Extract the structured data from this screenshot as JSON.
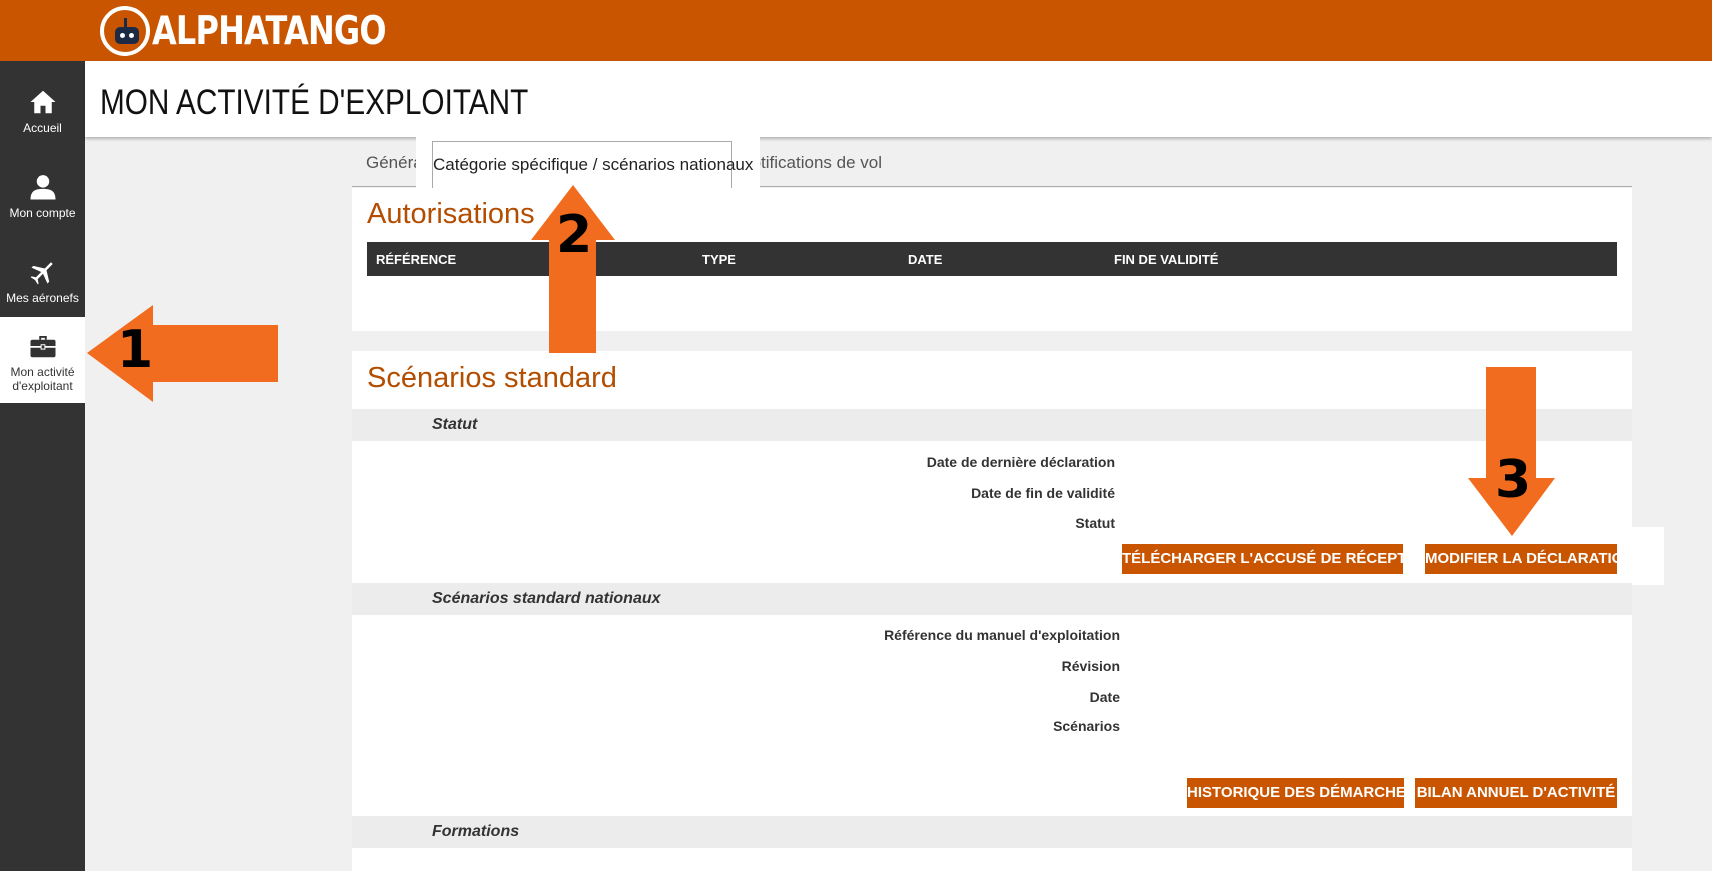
{
  "app": {
    "logo_text": "ALPHATANGO"
  },
  "sidebar": {
    "items": [
      {
        "label": "Accueil",
        "icon": "home-icon"
      },
      {
        "label": "Mon compte",
        "icon": "user-icon"
      },
      {
        "label": "Mes aéronefs",
        "icon": "airplane-icon"
      },
      {
        "label": "Mon activité d'exploitant",
        "icon": "briefcase-icon",
        "active": true
      }
    ]
  },
  "header": {
    "title": "MON ACTIVITÉ D'EXPLOITANT"
  },
  "tabs": [
    {
      "label": "Général"
    },
    {
      "label": "Catégorie spécifique / scénarios nationaux",
      "active": true
    },
    {
      "label": "Notifications de vol"
    }
  ],
  "authorisations": {
    "title": "Autorisations",
    "columns": [
      "RÉFÉRENCE",
      "TYPE",
      "DATE",
      "FIN DE VALIDITÉ"
    ]
  },
  "standard": {
    "title": "Scénarios standard",
    "statut": {
      "heading": "Statut",
      "fields": [
        "Date de dernière déclaration",
        "Date de fin de validité",
        "Statut"
      ],
      "buttons": [
        "TÉLÉCHARGER L'ACCUSÉ DE RÉCEPTION",
        "MODIFIER LA DÉCLARATION"
      ]
    },
    "nationaux": {
      "heading": "Scénarios standard nationaux",
      "fields": [
        "Référence du manuel d'exploitation",
        "Révision",
        "Date",
        "Scénarios"
      ],
      "buttons": [
        "HISTORIQUE DES DÉMARCHES",
        "BILAN ANNUEL D'ACTIVITÉ"
      ]
    },
    "formations": {
      "heading": "Formations"
    }
  },
  "annotations": {
    "arrow_color": "#f26c1f",
    "labels": [
      "1",
      "2",
      "3"
    ]
  },
  "colors": {
    "brand": "#c95500",
    "sidebar": "#333333",
    "title_accent": "#b34d00"
  }
}
